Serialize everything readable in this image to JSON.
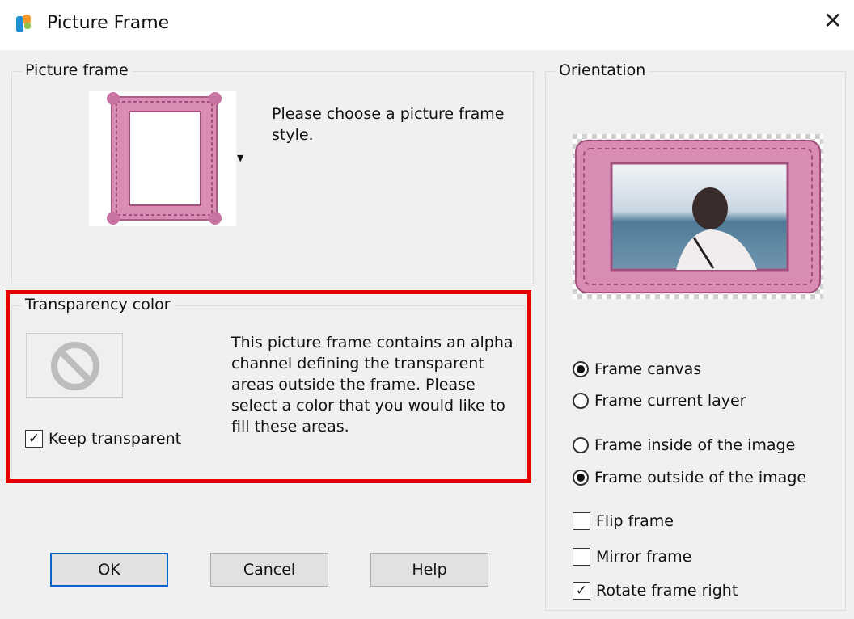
{
  "window": {
    "title": "Picture Frame",
    "close_glyph": "✕",
    "app_icon": "psp-icon"
  },
  "picture_frame": {
    "label": "Picture frame",
    "instruction": "Please choose a picture frame style.",
    "dropdown_glyph": "▼"
  },
  "transparency": {
    "label": "Transparency color",
    "description": "This picture frame contains an alpha channel defining the transparent areas outside the frame.  Please select a color that you would like to fill these areas.",
    "keep_transparent": {
      "label": "Keep transparent",
      "checked": true
    },
    "swatch_icon": "no-color-icon"
  },
  "orientation": {
    "label": "Orientation",
    "frame_canvas": {
      "label": "Frame canvas",
      "selected": true
    },
    "frame_current_layer": {
      "label": "Frame current layer",
      "selected": false
    },
    "frame_inside": {
      "label": "Frame inside of the image",
      "selected": false
    },
    "frame_outside": {
      "label": "Frame outside of the image",
      "selected": true
    },
    "flip_frame": {
      "label": "Flip frame",
      "checked": false
    },
    "mirror_frame": {
      "label": "Mirror frame",
      "checked": false
    },
    "rotate_frame_right": {
      "label": "Rotate frame right",
      "checked": true
    }
  },
  "buttons": {
    "ok": "OK",
    "cancel": "Cancel",
    "help": "Help"
  },
  "check_glyph": "✓",
  "colors": {
    "highlight": "#e80000",
    "frame_pink": "#d98cb4",
    "default_button_border": "#0a64c8"
  }
}
